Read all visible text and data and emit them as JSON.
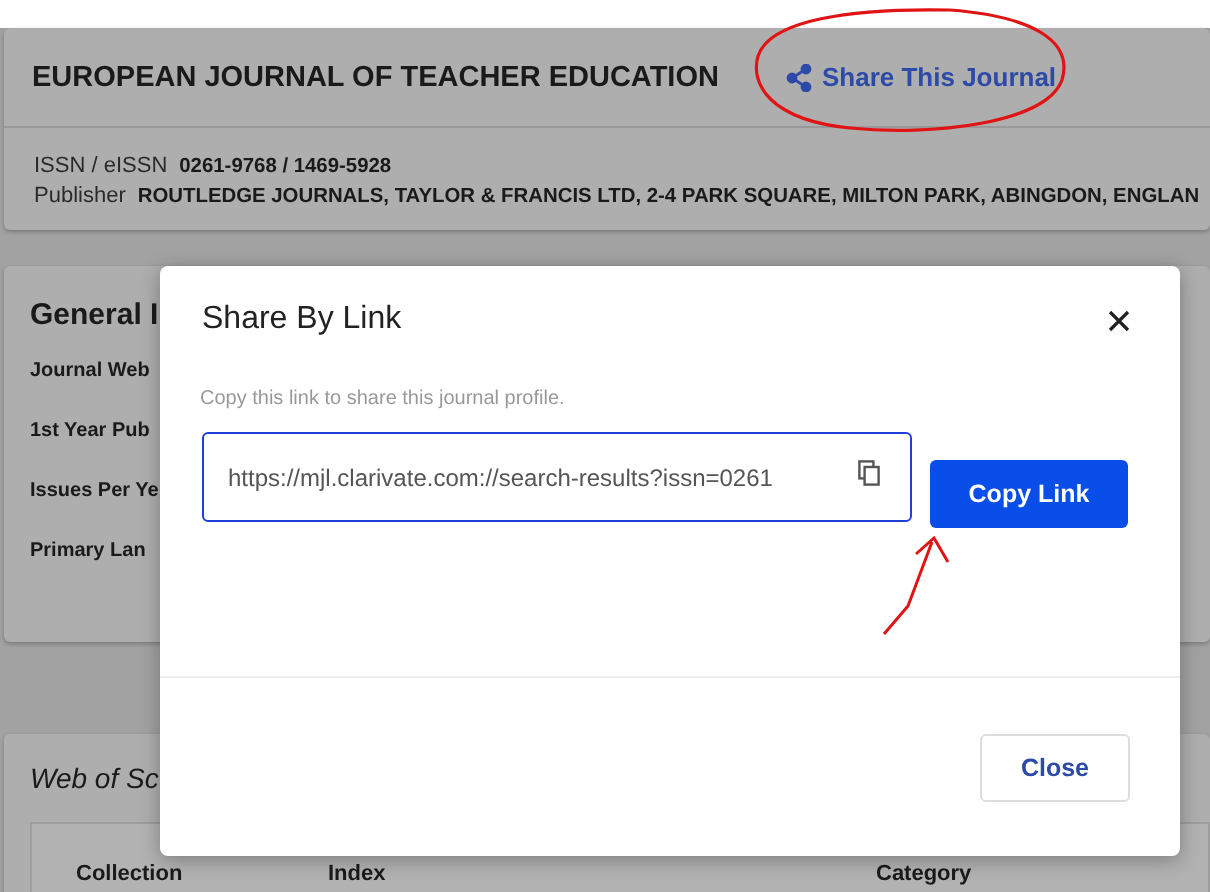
{
  "journal": {
    "title": "EUROPEAN JOURNAL OF TEACHER EDUCATION",
    "share_link": "Share This Journal",
    "issn_label": "ISSN / eISSN",
    "issn_value": "0261-9768 / 1469-5928",
    "publisher_label": "Publisher",
    "publisher_value": "ROUTLEDGE JOURNALS, TAYLOR & FRANCIS LTD, 2-4 PARK SQUARE, MILTON PARK, ABINGDON, ENGLAN"
  },
  "general": {
    "heading": "General I",
    "fields": [
      "Journal Web",
      "1st Year Pub",
      "Issues Per Ye",
      "Primary Lan"
    ]
  },
  "wos": {
    "heading": "Web of Sc",
    "columns": [
      "Collection",
      "Index",
      "Category"
    ]
  },
  "modal": {
    "title": "Share By Link",
    "hint": "Copy this link to share this journal profile.",
    "link_value": "https://mjl.clarivate.com://search-results?issn=0261",
    "copy_button": "Copy Link",
    "close_button": "Close"
  }
}
